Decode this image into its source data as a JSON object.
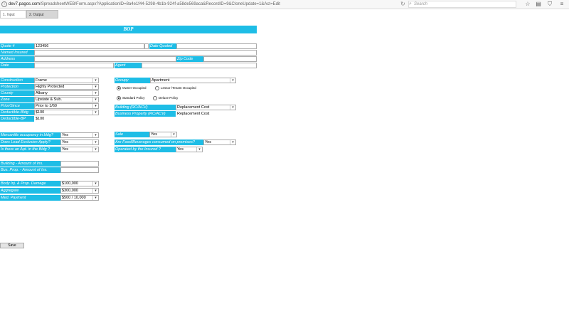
{
  "browser": {
    "url_host": "dev7.pagos.com",
    "url_path": "/SpreadsheetWEB/Form.aspx?ApplicationID=8a4e1f44-5298-4b1b-924f-a58de569aca&RecordID=9&CloneUpdate=1&Act=Edit",
    "search_placeholder": "Search",
    "icons": [
      "star-icon",
      "reading-list-icon",
      "shield-icon",
      "more-icon"
    ]
  },
  "tabs": [
    {
      "label": "1. Input"
    },
    {
      "label": "2. Output"
    }
  ],
  "form": {
    "title": "BOP",
    "quote_label": "Quote #",
    "quote_value": "123456",
    "date_quoted_label": "Date Quoted",
    "date_quoted_value": "",
    "named_insured_label": "Named Insured",
    "named_insured_value": "",
    "address_label": "Address",
    "address_value": "",
    "zip_label": "Zip Code",
    "zip_value": "",
    "date_label": "Date",
    "date_value": "",
    "agent_label": "Agent",
    "agent_value": "",
    "left_selects": [
      {
        "label": "Construction",
        "value": "Frame"
      },
      {
        "label": "Protection",
        "value": "Highly Protected"
      },
      {
        "label": "County",
        "value": "Albany"
      },
      {
        "label": "Zone",
        "value": "Upstate & Sub."
      },
      {
        "label": "Prior/Since",
        "value": "Prior to 1/60"
      },
      {
        "label": "Deductible-Bldg",
        "value": "$100"
      }
    ],
    "deductible_bp_label": "Deductible-BP",
    "deductible_bp_value": "$100",
    "occupy_label": "Occupy",
    "occupy_value": "Apartment",
    "occupancy_radios": [
      {
        "label": "Owner Occupied",
        "checked": true
      },
      {
        "label": "Lessor /Tenant Occupied",
        "checked": false
      }
    ],
    "policy_radios": [
      {
        "label": "Standard Policy",
        "checked": true
      },
      {
        "label": "Deluxe Policy",
        "checked": false
      }
    ],
    "building_label": "Building (RC/ACV)",
    "building_value": "Replacement Cost",
    "business_property_label": "Business Property (RC/ACV)",
    "business_property_value": "Replacement Cost",
    "yes_no_left": [
      {
        "label": "Mercantile occupancy in bldg?",
        "value": "Yes"
      },
      {
        "label": "Does Lead Exclusion Apply?",
        "value": "Yes"
      },
      {
        "label": "Is there an Apt. in the Bldg ?",
        "value": "Yes"
      }
    ],
    "sale_label": "Sale",
    "sale_value": "Yes",
    "food_label": "Are Food/Beverages consumed on premises?",
    "food_value": "Yes",
    "operated_label": "Operated by  the Insured ?",
    "operated_value": "Yes",
    "building_ins_label": "Building - Amount of Ins.",
    "building_ins_value": "",
    "bus_prop_ins_label": "Bus. Prop. - Amount of Ins.",
    "bus_prop_ins_value": "",
    "liability": [
      {
        "label": "Body Inj. & Prop. Damage",
        "value": "$100,000"
      },
      {
        "label": "Aggregate",
        "value": "$300,000"
      },
      {
        "label": "Med. Payment",
        "value": "$500 / 10,000"
      }
    ],
    "save_label": "Save"
  }
}
